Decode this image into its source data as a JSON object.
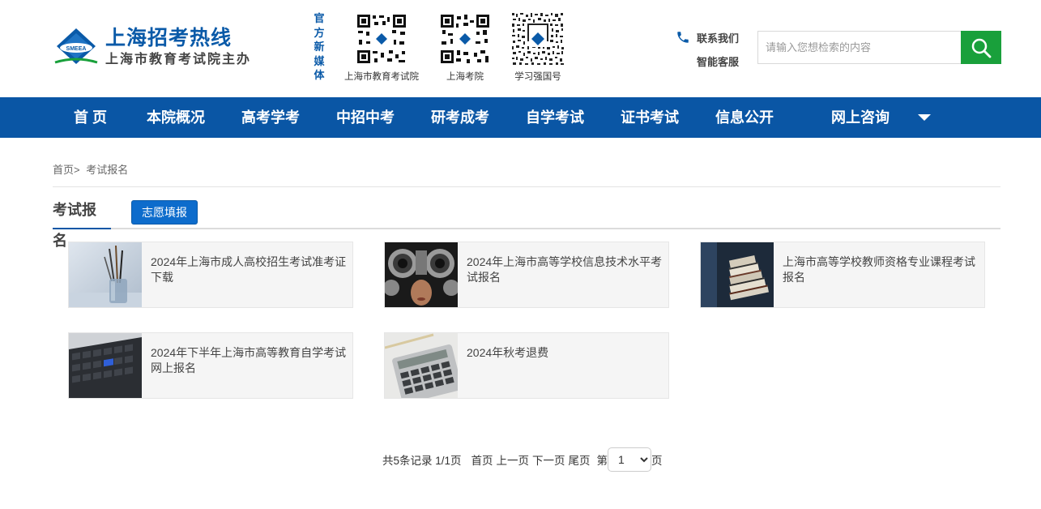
{
  "header": {
    "logo_title": "上海招考热线",
    "logo_sub": "上海市教育考试院主办",
    "logo_badge": "SMEEA",
    "media_label": [
      "官",
      "方",
      "新",
      "媒",
      "体"
    ],
    "qrcodes": [
      {
        "caption": "上海市教育考试院"
      },
      {
        "caption": "上海考院"
      },
      {
        "caption": "学习强国号"
      }
    ],
    "contact_us": "联系我们",
    "smart_service": "智能客服",
    "search_placeholder": "请输入您想检索的内容"
  },
  "nav": {
    "items": [
      "首 页",
      "本院概况",
      "高考学考",
      "中招中考",
      "研考成考",
      "自学考试",
      "证书考试",
      "信息公开",
      "网上咨询"
    ]
  },
  "breadcrumb": {
    "home": "首页>",
    "current": "考试报名"
  },
  "tabs": {
    "active": "考试报名",
    "secondary": "志愿填报"
  },
  "cards": [
    {
      "title": "2024年上海市成人高校招生考试准考证下载",
      "thumb": "pens-in-cup"
    },
    {
      "title": "2024年上海市高等学校信息技术水平考试报名",
      "thumb": "eye-test-machine"
    },
    {
      "title": "上海市高等学校教师资格专业课程考试报名",
      "thumb": "stack-of-books"
    },
    {
      "title": "2024年下半年上海市高等教育自学考试网上报名",
      "thumb": "keyboard"
    },
    {
      "title": "2024年秋考退费",
      "thumb": "calculator"
    }
  ],
  "pager": {
    "summary": "共5条记录 1/1页",
    "first": "首页",
    "prev": "上一页",
    "next": "下一页",
    "last": "尾页",
    "page_prefix": "第",
    "page_value": "1",
    "page_suffix": "页"
  },
  "colors": {
    "nav_bg": "#0a56a5",
    "brand_blue": "#0a5aa8",
    "search_green": "#19a03b"
  }
}
